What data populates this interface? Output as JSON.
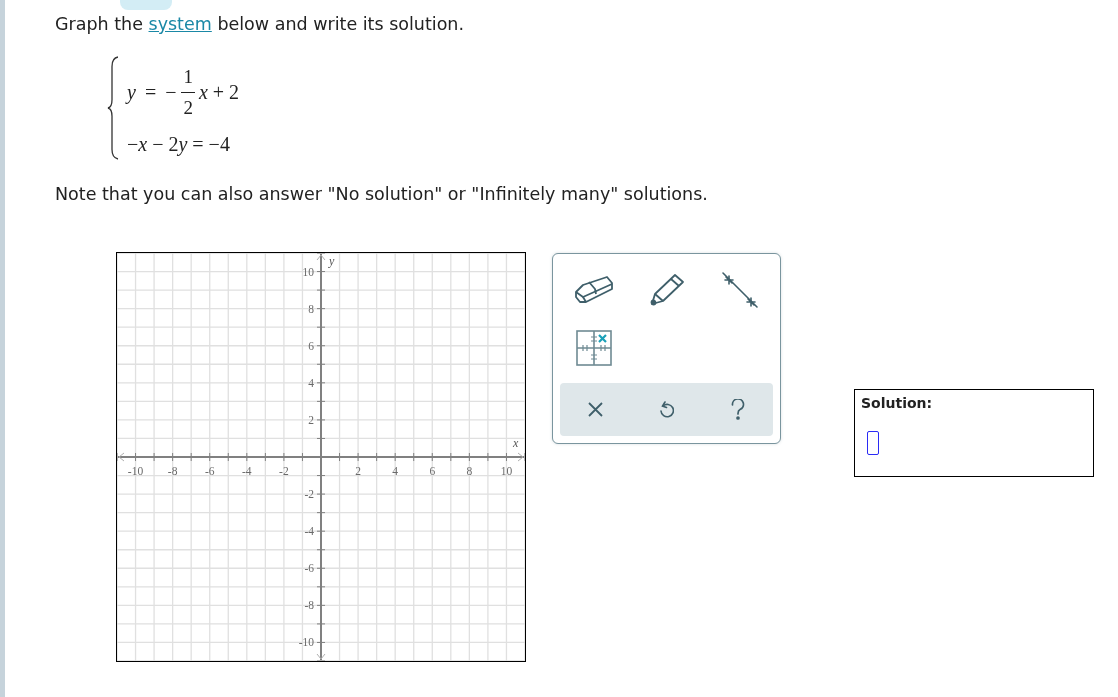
{
  "instruction": {
    "before": "Graph the ",
    "link": "system",
    "after": " below and write its solution."
  },
  "system": {
    "equations": [
      {
        "kind": "fraction",
        "before": "*y* = −",
        "numerator": "1",
        "denominator": "2",
        "after": "*x* + 2"
      },
      {
        "kind": "plain",
        "parts": [
          "−*x* − 2",
          "*y* = −4"
        ]
      }
    ]
  },
  "note": "Note that you can also answer \"No solution\" or \"Infinitely many\" solutions.",
  "graph": {
    "chart_data": {
      "type": "line",
      "xlabel": "x",
      "ylabel": "y",
      "xlim": [
        -11,
        11
      ],
      "ylim": [
        -11,
        11
      ],
      "grid": true,
      "xticks": [
        {
          "value": -10,
          "label": "-10"
        },
        {
          "value": -8,
          "label": "-8"
        },
        {
          "value": -6,
          "label": "-6"
        },
        {
          "value": -4,
          "label": "-4"
        },
        {
          "value": -2,
          "label": "-2"
        },
        {
          "value": 2,
          "label": "2"
        },
        {
          "value": 4,
          "label": "4"
        },
        {
          "value": 6,
          "label": "6"
        },
        {
          "value": 8,
          "label": "8"
        },
        {
          "value": 10,
          "label": "10"
        }
      ],
      "yticks": [
        {
          "value": -10,
          "label": "-10"
        },
        {
          "value": -8,
          "label": "-8"
        },
        {
          "value": -6,
          "label": "-6"
        },
        {
          "value": -4,
          "label": "-4"
        },
        {
          "value": -2,
          "label": "-2"
        },
        {
          "value": 2,
          "label": "2"
        },
        {
          "value": 4,
          "label": "4"
        },
        {
          "value": 6,
          "label": "6"
        },
        {
          "value": 8,
          "label": "8"
        },
        {
          "value": 10,
          "label": "10"
        }
      ]
    }
  },
  "toolbox": {
    "tools": [
      {
        "kind": "eraser"
      },
      {
        "kind": "pencil"
      },
      {
        "kind": "line"
      },
      {
        "kind": "point"
      }
    ],
    "actions": [
      {
        "kind": "clear"
      },
      {
        "kind": "undo"
      },
      {
        "kind": "help"
      }
    ]
  },
  "solution": {
    "label": "Solution:"
  }
}
